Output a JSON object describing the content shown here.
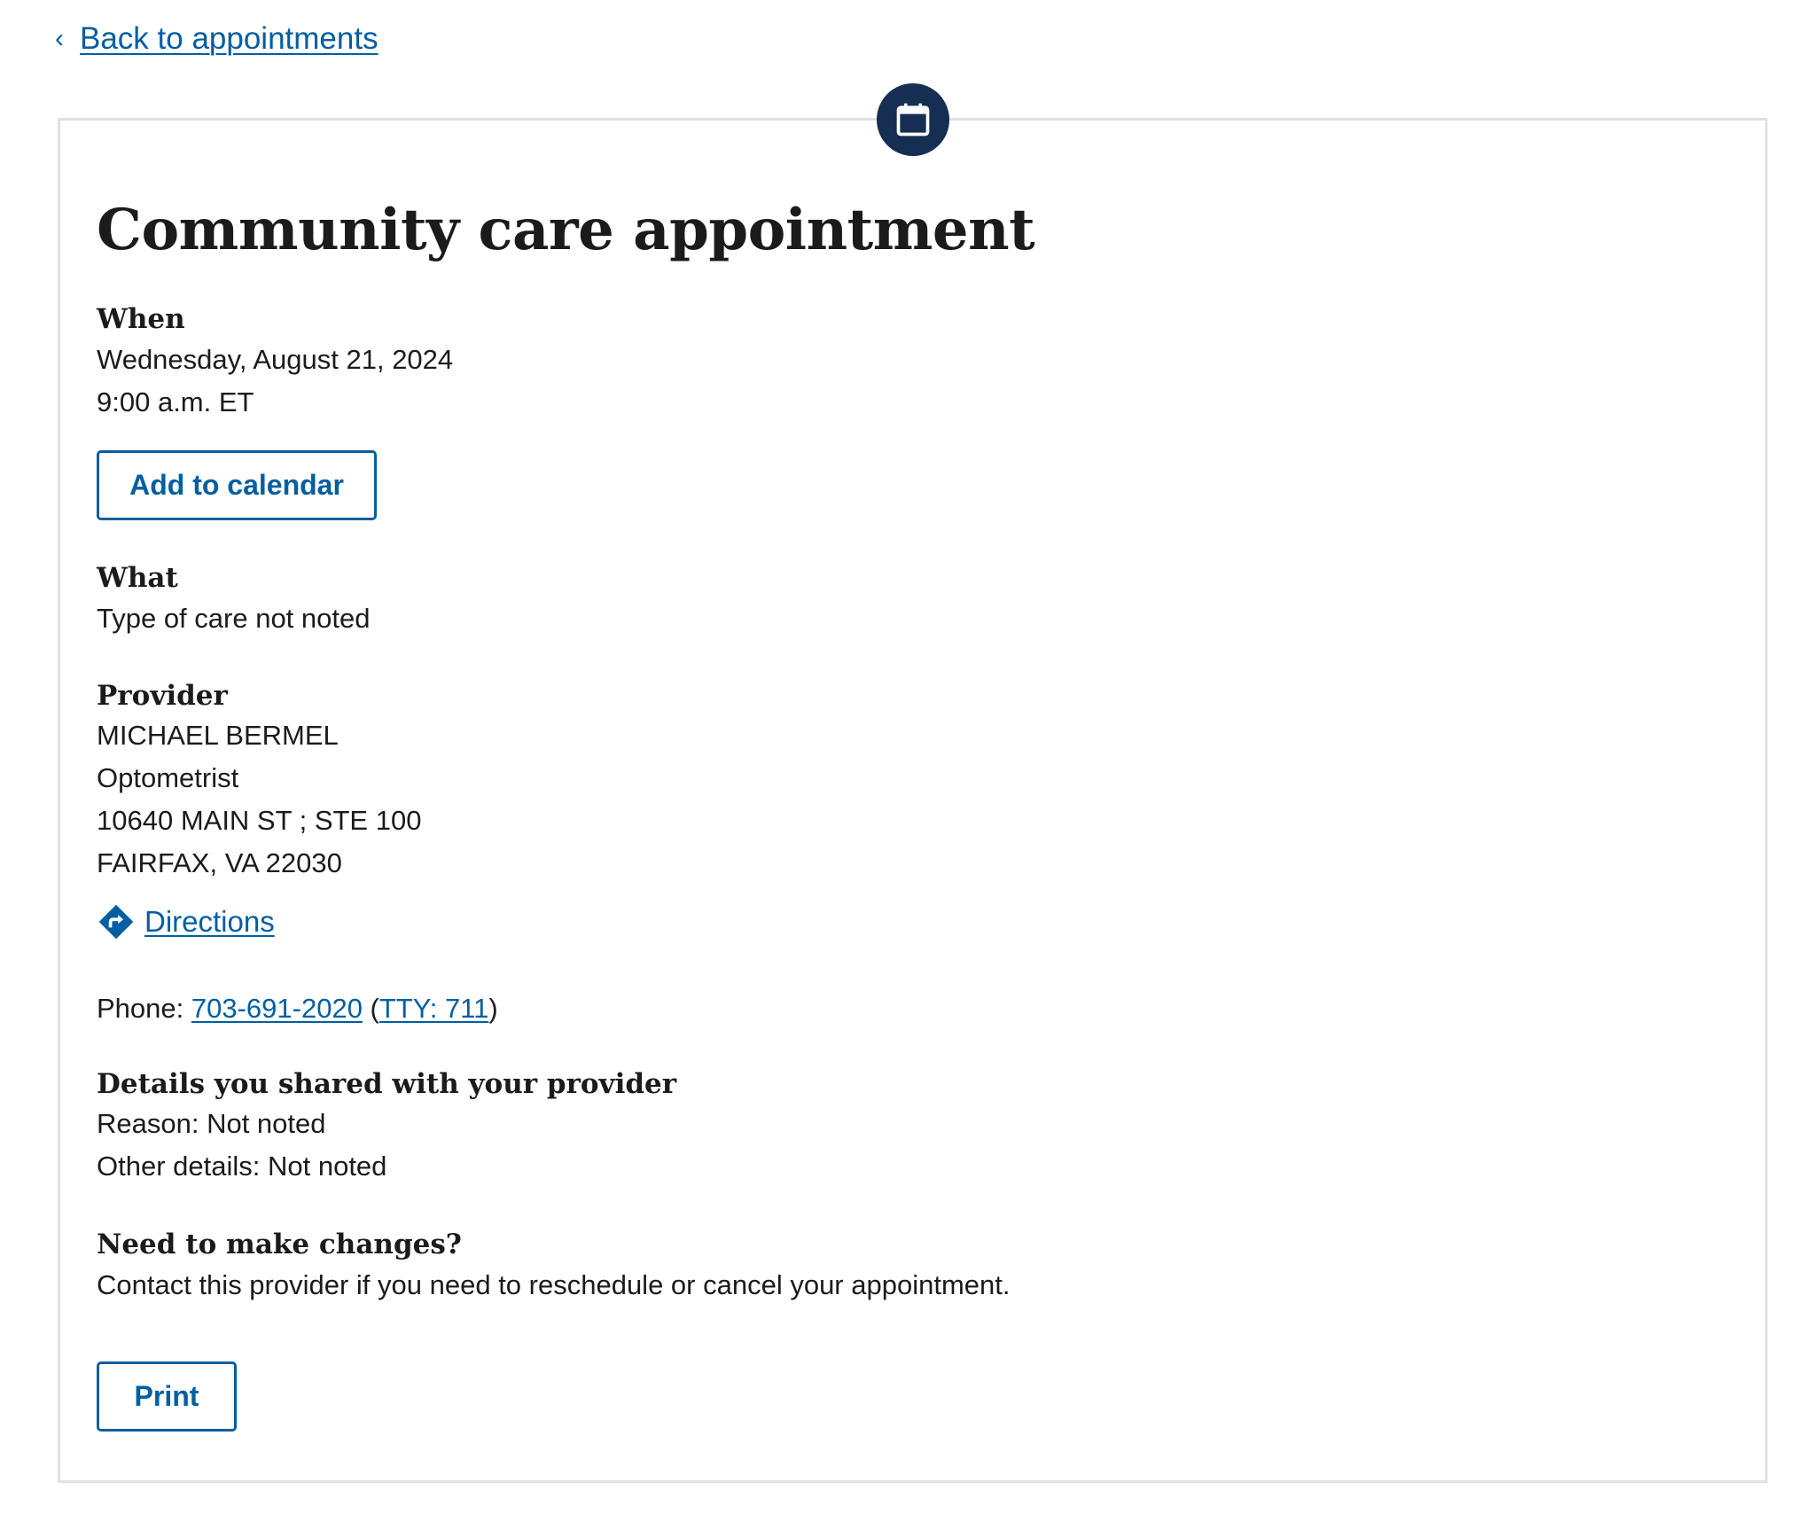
{
  "nav": {
    "back_chevron": "‹",
    "back_label": "Back to appointments"
  },
  "appointment": {
    "icon": "calendar-icon",
    "title": "Community care appointment",
    "when": {
      "heading": "When",
      "date": "Wednesday, August 21, 2024",
      "time": "9:00 a.m. ET",
      "add_to_calendar_label": "Add to calendar"
    },
    "what": {
      "heading": "What",
      "type_of_care": "Type of care not noted"
    },
    "provider": {
      "heading": "Provider",
      "name": "MICHAEL BERMEL",
      "specialty": "Optometrist",
      "address_line1": "10640 MAIN ST ; STE 100",
      "address_line2": "FAIRFAX, VA 22030",
      "directions_label": "Directions",
      "directions_icon": "directions-icon",
      "phone_prefix": "Phone: ",
      "phone_number": "703-691-2020",
      "tty_open": " (",
      "tty_label": "TTY: 711",
      "tty_close": ")"
    },
    "details": {
      "heading": "Details you shared with your provider",
      "reason": "Reason: Not noted",
      "other": "Other details: Not noted"
    },
    "changes": {
      "heading": "Need to make changes?",
      "text": "Contact this provider if you need to reschedule or cancel your appointment."
    },
    "print_label": "Print"
  },
  "colors": {
    "link": "#005ea2",
    "badge": "#162e51",
    "border": "#dfe1e2",
    "text": "#1b1b1b"
  }
}
